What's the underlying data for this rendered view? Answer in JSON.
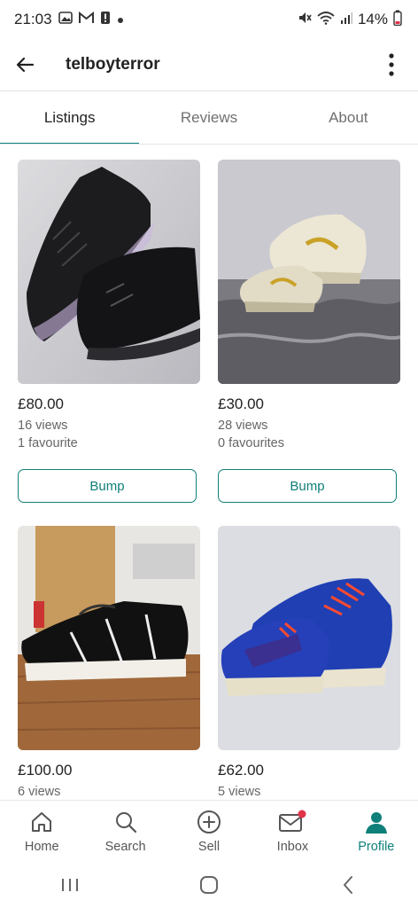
{
  "status_bar": {
    "time": "21:03",
    "battery": "14%"
  },
  "header": {
    "title": "telboyterror"
  },
  "tabs": [
    {
      "label": "Listings",
      "active": true
    },
    {
      "label": "Reviews",
      "active": false
    },
    {
      "label": "About",
      "active": false
    }
  ],
  "listings": [
    {
      "price": "£80.00",
      "views": "16 views",
      "favourites": "1 favourite",
      "bump_label": "Bump",
      "image": "black-sneakers"
    },
    {
      "price": "£30.00",
      "views": "28 views",
      "favourites": "0 favourites",
      "bump_label": "Bump",
      "image": "white-gold-sneakers"
    },
    {
      "price": "£100.00",
      "views": "6 views",
      "image": "black-strap-sneakers"
    },
    {
      "price": "£62.00",
      "views": "5 views",
      "image": "blue-orange-sneakers"
    }
  ],
  "bottom_nav": [
    {
      "label": "Home",
      "icon": "home-icon",
      "active": false
    },
    {
      "label": "Search",
      "icon": "search-icon",
      "active": false
    },
    {
      "label": "Sell",
      "icon": "plus-circle-icon",
      "active": false
    },
    {
      "label": "Inbox",
      "icon": "mail-icon",
      "active": false,
      "badge": true
    },
    {
      "label": "Profile",
      "icon": "person-icon",
      "active": true
    }
  ],
  "colors": {
    "accent": "#0f7f7a",
    "badge": "#e0334a"
  }
}
